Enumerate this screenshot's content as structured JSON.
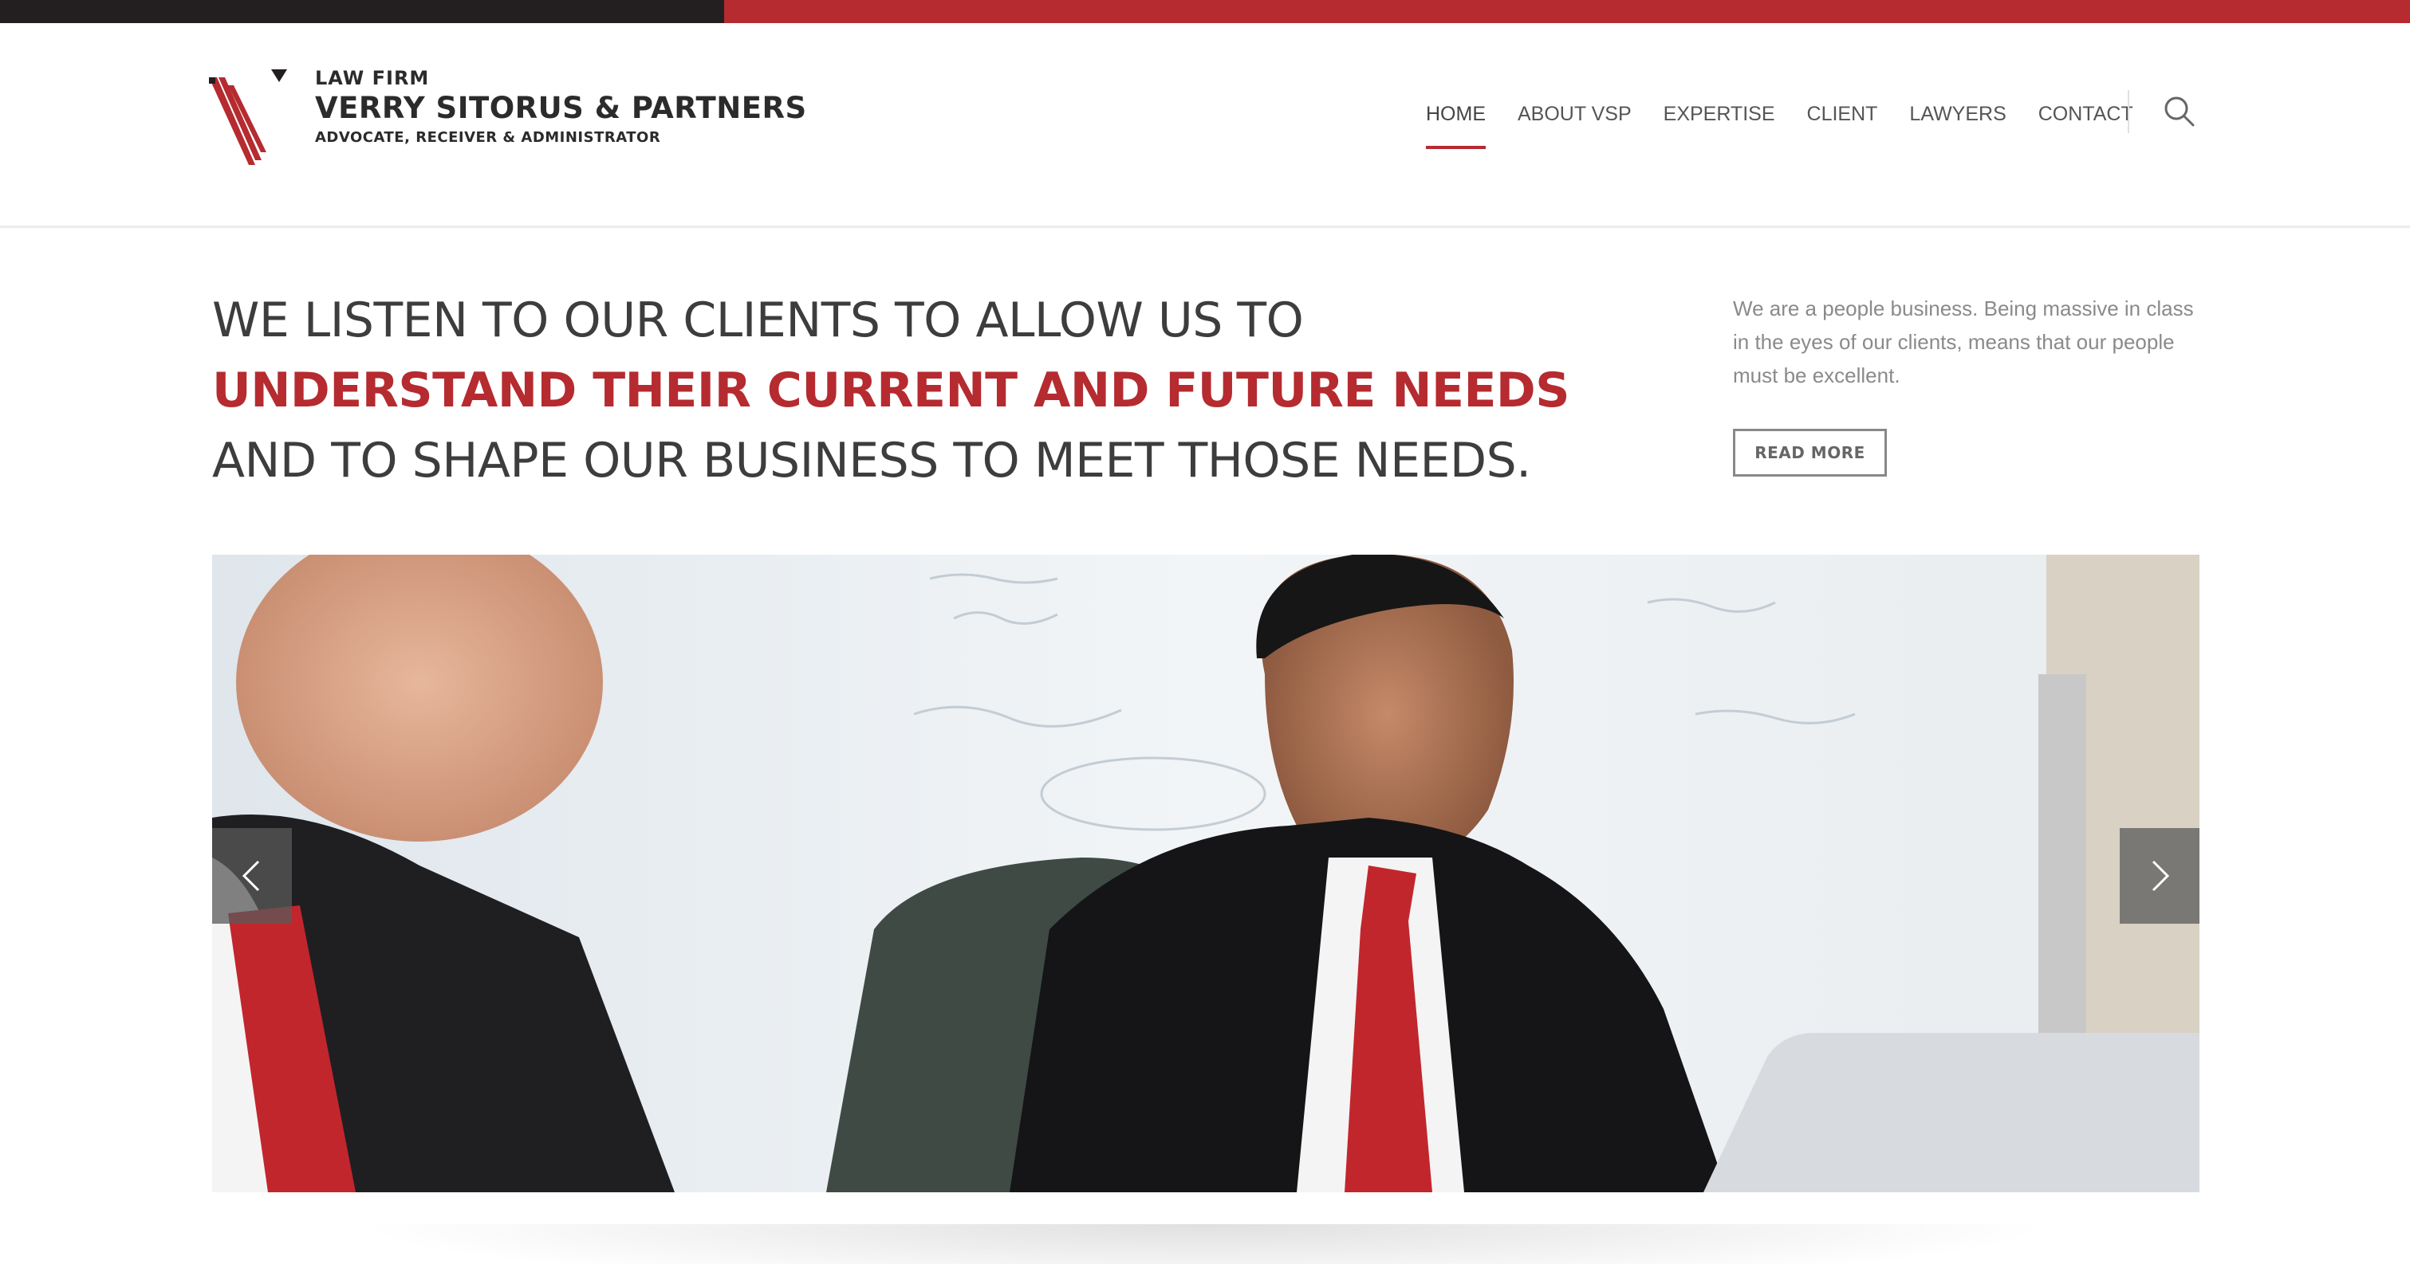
{
  "brand": {
    "line1": "LAW FIRM",
    "line2": "VERRY SITORUS & PARTNERS",
    "line3": "ADVOCATE, RECEIVER & ADMINISTRATOR",
    "accent_color": "#b52b30",
    "dark_color": "#231f20"
  },
  "nav": {
    "items": [
      {
        "label": "HOME",
        "active": true
      },
      {
        "label": "ABOUT VSP",
        "active": false
      },
      {
        "label": "EXPERTISE",
        "active": false
      },
      {
        "label": "CLIENT",
        "active": false
      },
      {
        "label": "LAWYERS",
        "active": false
      },
      {
        "label": "CONTACT",
        "active": false
      }
    ],
    "search_icon": "search-icon"
  },
  "hero": {
    "headline_part1": "WE LISTEN TO OUR CLIENTS TO ALLOW US TO ",
    "headline_highlight": "UNDERSTAND THEIR CURRENT AND FUTURE NEEDS",
    "headline_part2": " AND TO SHAPE OUR BUSINESS TO MEET THOSE NEEDS.",
    "intro": "We are a people business. Being massive in class in the eyes of our clients, means that our people must be excellent.",
    "read_more_label": "READ MORE"
  },
  "slider": {
    "prev_icon": "chevron-left-icon",
    "next_icon": "chevron-right-icon"
  }
}
